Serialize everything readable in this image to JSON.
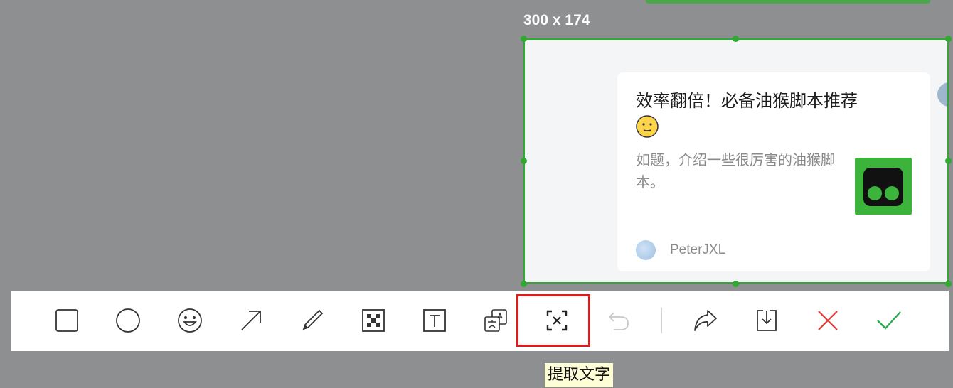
{
  "selection": {
    "size_label": "300 x 174"
  },
  "card": {
    "title": "效率翻倍！必备油猴脚本推荐",
    "emoji_icon": "smiling-face-emoji",
    "description": "如题，介绍一些很厉害的油猴脚本。",
    "author": "PeterJXL",
    "thumbnail_icon": "tampermonkey-logo"
  },
  "toolbar": {
    "tools": [
      {
        "name": "rectangle-tool",
        "icon": "square-outline-icon"
      },
      {
        "name": "ellipse-tool",
        "icon": "circle-outline-icon"
      },
      {
        "name": "emoji-tool",
        "icon": "smiley-icon"
      },
      {
        "name": "arrow-tool",
        "icon": "arrow-up-right-icon"
      },
      {
        "name": "pen-tool",
        "icon": "pen-icon"
      },
      {
        "name": "mosaic-tool",
        "icon": "mosaic-icon"
      },
      {
        "name": "text-tool",
        "icon": "text-box-icon"
      },
      {
        "name": "translate-tool",
        "icon": "translate-icon"
      },
      {
        "name": "extract-text-tool",
        "icon": "text-recognition-icon"
      },
      {
        "name": "undo-button",
        "icon": "undo-icon"
      },
      {
        "name": "share-button",
        "icon": "share-icon"
      },
      {
        "name": "download-button",
        "icon": "download-icon"
      },
      {
        "name": "cancel-button",
        "icon": "close-icon"
      },
      {
        "name": "confirm-button",
        "icon": "check-icon"
      }
    ],
    "colors": {
      "highlight": "#d91c1c",
      "cancel": "#e53935",
      "confirm": "#2eaa55",
      "selection": "#31a831"
    }
  },
  "tooltip": {
    "text": "提取文字"
  }
}
